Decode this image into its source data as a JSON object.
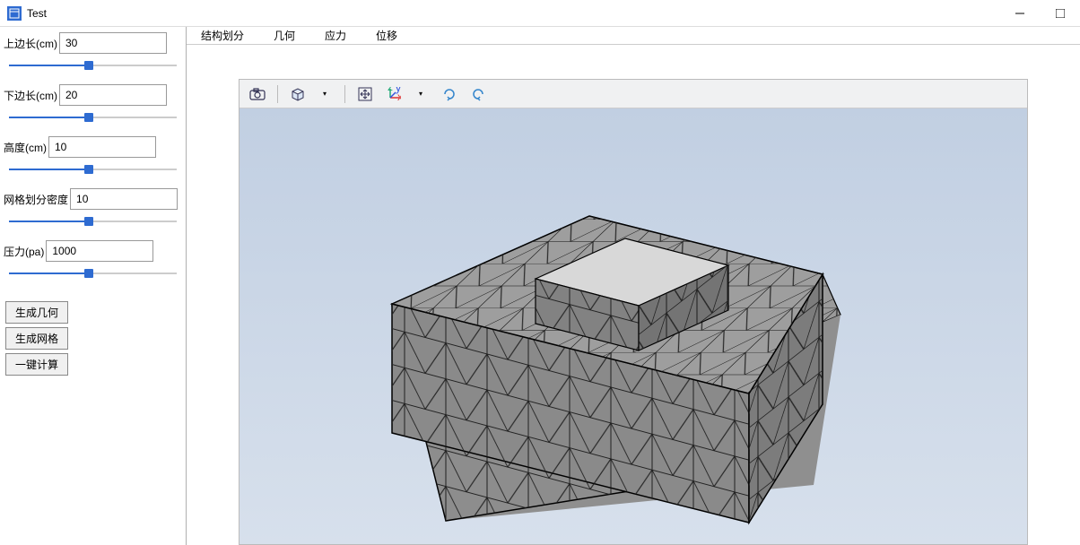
{
  "window": {
    "title": "Test"
  },
  "sidebar": {
    "params": [
      {
        "label": "上边长(cm)",
        "value": "30",
        "slider_percent": 48
      },
      {
        "label": "下边长(cm)",
        "value": "20",
        "slider_percent": 48
      },
      {
        "label": "高度(cm)",
        "value": "10",
        "slider_percent": 48
      },
      {
        "label": "网格划分密度",
        "value": "10",
        "slider_percent": 48
      },
      {
        "label": "压力(pa)",
        "value": "1000",
        "slider_percent": 48
      }
    ],
    "buttons": {
      "generate_geometry": "生成几何",
      "generate_mesh": "生成网格",
      "compute": "一键计算"
    }
  },
  "tabs": {
    "items": [
      {
        "label": "结构划分",
        "active": true
      },
      {
        "label": "几何",
        "active": false
      },
      {
        "label": "应力",
        "active": false
      },
      {
        "label": "位移",
        "active": false
      }
    ]
  },
  "toolbar": {
    "icons": [
      "camera-icon",
      "cube-view-icon",
      "fit-view-icon",
      "axis-icon",
      "rotate-cw-icon",
      "rotate-ccw-icon"
    ]
  }
}
